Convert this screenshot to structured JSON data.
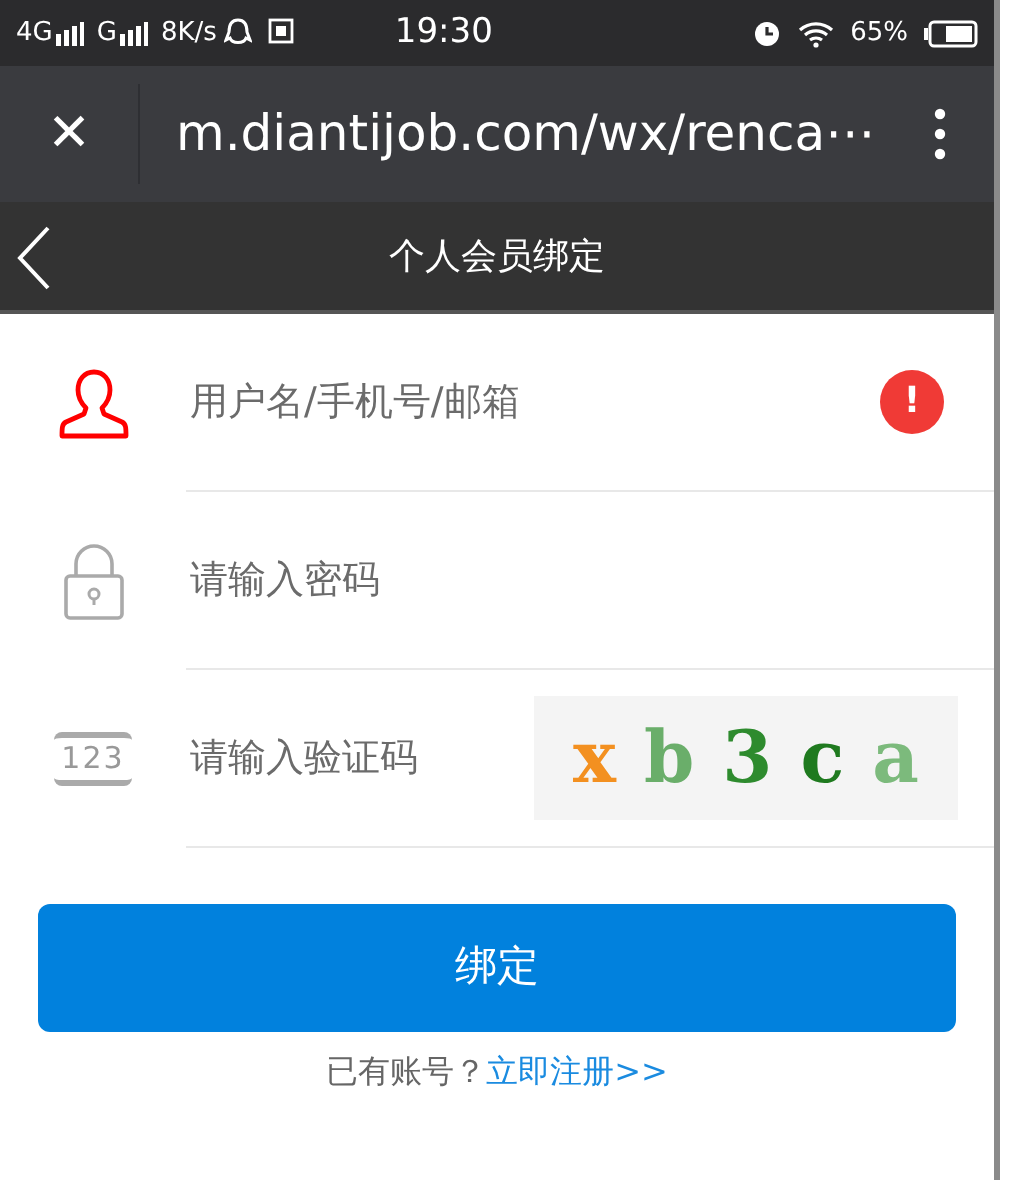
{
  "status_bar": {
    "network_1": "4G",
    "network_2": "G",
    "speed": "8K/s",
    "time": "19:30",
    "battery": "65%"
  },
  "browser_bar": {
    "close": "✕",
    "url": "m.diantijob.com/wx/renca⋯"
  },
  "header": {
    "title": "个人会员绑定"
  },
  "fields": [
    {
      "kind": "user",
      "placeholder": "用户名/手机号/邮箱",
      "error": true,
      "error_mark": "!"
    },
    {
      "kind": "password",
      "placeholder": "请输入密码",
      "error": false
    },
    {
      "kind": "captcha",
      "placeholder": "请输入验证码",
      "error": false,
      "icon_text": "123",
      "captcha": [
        {
          "char": "x",
          "color": "#f39020"
        },
        {
          "char": "b",
          "color": "#6aae6a"
        },
        {
          "char": "3",
          "color": "#2e8b2e"
        },
        {
          "char": "c",
          "color": "#1f7a1f"
        },
        {
          "char": "a",
          "color": "#7cba7c"
        }
      ]
    }
  ],
  "submit_button": "绑定",
  "footer": {
    "prompt": "已有账号？",
    "link": "立即注册>>"
  }
}
